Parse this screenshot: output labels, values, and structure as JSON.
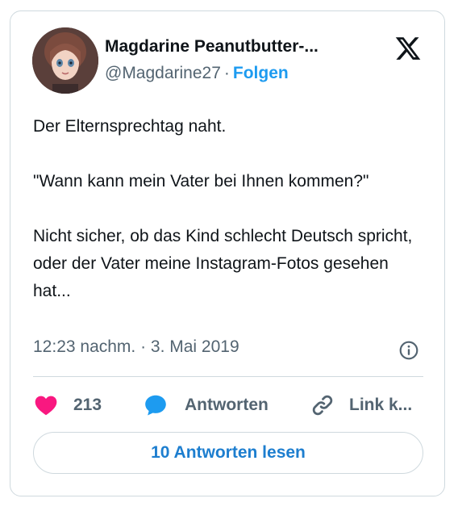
{
  "author": {
    "display_name": "Magdarine Peanutbutter-...",
    "handle": "@Magdarine27",
    "separator": "·",
    "follow_label": "Folgen"
  },
  "tweet": {
    "text": "Der Elternsprechtag naht.\n\n\"Wann kann mein Vater bei Ihnen kommen?\"\n\nNicht sicher, ob das Kind schlecht Deutsch spricht, oder der Vater meine Instagram-Fotos gesehen hat...",
    "timestamp": "12:23 nachm. · 3. Mai 2019"
  },
  "actions": {
    "like_count": "213",
    "reply_label": "Antworten",
    "copy_link_label": "Link k..."
  },
  "read_replies_label": "10 Antworten lesen",
  "icons": {
    "brand": "x-logo-icon",
    "info": "info-icon",
    "like": "heart-icon",
    "reply": "speech-bubble-icon",
    "copy_link": "link-icon"
  },
  "colors": {
    "follow": "#1d9bf0",
    "heart": "#f91880",
    "reply_bubble": "#1d9bf0",
    "button_text": "#1d7ecf",
    "secondary_text": "#536471",
    "border": "#cfd9de"
  }
}
